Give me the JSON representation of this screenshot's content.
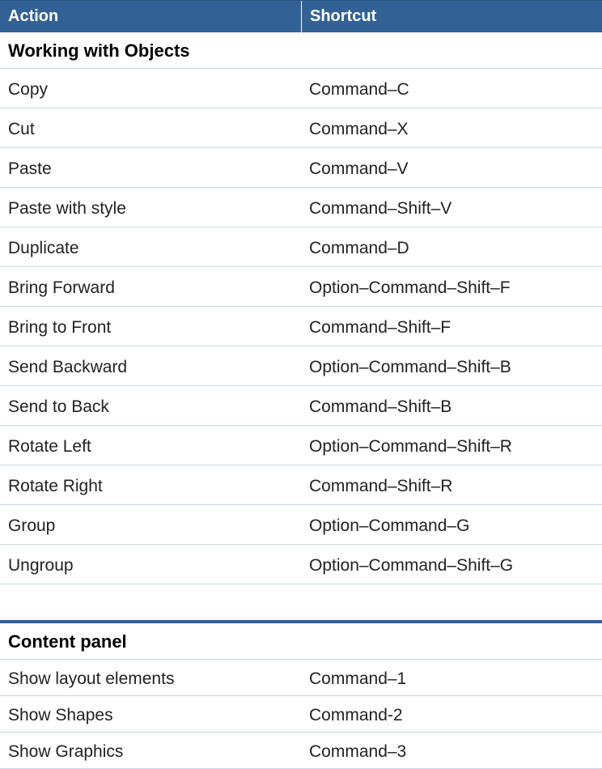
{
  "colors": {
    "headerBg": "#326295",
    "rowBorder": "#c7d6e6"
  },
  "headers": {
    "action": "Action",
    "shortcut": "Shortcut"
  },
  "sections": [
    {
      "title": "Working with Objects",
      "rows": [
        {
          "action": "Copy",
          "shortcut": "Command–C"
        },
        {
          "action": "Cut",
          "shortcut": "Command–X"
        },
        {
          "action": "Paste",
          "shortcut": "Command–V"
        },
        {
          "action": "Paste with style",
          "shortcut": "Command–Shift–V"
        },
        {
          "action": "Duplicate",
          "shortcut": "Command–D"
        },
        {
          "action": "Bring Forward",
          "shortcut": "Option–Command–Shift–F"
        },
        {
          "action": "Bring to Front",
          "shortcut": "Command–Shift–F"
        },
        {
          "action": "Send Backward",
          "shortcut": "Option–Command–Shift–B"
        },
        {
          "action": "Send to Back",
          "shortcut": "Command–Shift–B"
        },
        {
          "action": "Rotate Left",
          "shortcut": "Option–Command–Shift–R"
        },
        {
          "action": "Rotate Right",
          "shortcut": "Command–Shift–R"
        },
        {
          "action": "Group",
          "shortcut": "Option–Command–G"
        },
        {
          "action": "Ungroup",
          "shortcut": "Option–Command–Shift–G"
        }
      ]
    },
    {
      "title": "Content panel",
      "rows": [
        {
          "action": "Show layout elements",
          "shortcut": "Command–1"
        },
        {
          "action": "Show Shapes",
          "shortcut": "Command-2"
        },
        {
          "action": "Show Graphics",
          "shortcut": "Command–3"
        }
      ]
    }
  ]
}
